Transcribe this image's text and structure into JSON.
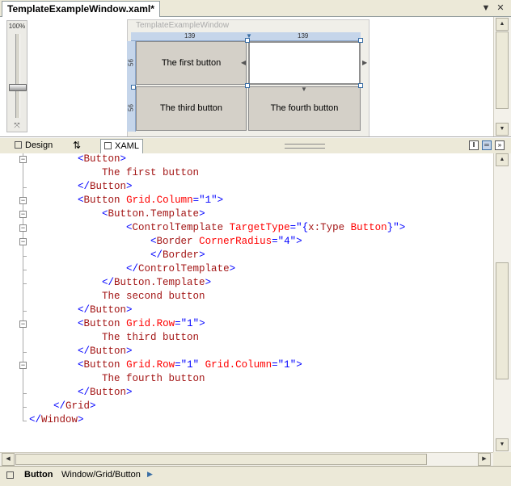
{
  "document_tab": {
    "title": "TemplateExampleWindow.xaml*"
  },
  "window_controls": {
    "dropdown": "▼",
    "close": "✕"
  },
  "designer": {
    "zoom": "100%",
    "window_title": "TemplateExampleWindow",
    "column_widths": [
      "139",
      "139"
    ],
    "row_heights": [
      "56",
      "56"
    ],
    "cells": [
      "The first button",
      "",
      "The third button",
      "The fourth button"
    ]
  },
  "view_tabs": {
    "design": "Design",
    "swap": "⇅",
    "xaml": "XAML"
  },
  "code": [
    [
      {
        "t": "        "
      },
      {
        "c": "b",
        "t": "<"
      },
      {
        "c": "m",
        "t": "Button"
      },
      {
        "c": "b",
        "t": ">"
      }
    ],
    [
      {
        "t": "            "
      },
      {
        "c": "m",
        "t": "The first button"
      }
    ],
    [
      {
        "t": "        "
      },
      {
        "c": "b",
        "t": "</"
      },
      {
        "c": "m",
        "t": "Button"
      },
      {
        "c": "b",
        "t": ">"
      }
    ],
    [
      {
        "t": "        "
      },
      {
        "c": "b",
        "t": "<"
      },
      {
        "c": "m",
        "t": "Button"
      },
      {
        "t": " "
      },
      {
        "c": "r",
        "t": "Grid.Column"
      },
      {
        "c": "b",
        "t": "=\""
      },
      {
        "c": "b",
        "t": "1"
      },
      {
        "c": "b",
        "t": "\">"
      }
    ],
    [
      {
        "t": "            "
      },
      {
        "c": "b",
        "t": "<"
      },
      {
        "c": "m",
        "t": "Button.Template"
      },
      {
        "c": "b",
        "t": ">"
      }
    ],
    [
      {
        "t": "                "
      },
      {
        "c": "b",
        "t": "<"
      },
      {
        "c": "m",
        "t": "ControlTemplate"
      },
      {
        "t": " "
      },
      {
        "c": "r",
        "t": "TargetType"
      },
      {
        "c": "b",
        "t": "=\""
      },
      {
        "c": "b",
        "t": "{"
      },
      {
        "c": "m",
        "t": "x:Type"
      },
      {
        "t": " "
      },
      {
        "c": "r",
        "t": "Button"
      },
      {
        "c": "b",
        "t": "}"
      },
      {
        "c": "b",
        "t": "\">"
      }
    ],
    [
      {
        "t": "                    "
      },
      {
        "c": "b",
        "t": "<"
      },
      {
        "c": "m",
        "t": "Border"
      },
      {
        "t": " "
      },
      {
        "c": "r",
        "t": "CornerRadius"
      },
      {
        "c": "b",
        "t": "=\""
      },
      {
        "c": "b",
        "t": "4"
      },
      {
        "c": "b",
        "t": "\">"
      }
    ],
    [
      {
        "t": "                    "
      },
      {
        "c": "b",
        "t": "</"
      },
      {
        "c": "m",
        "t": "Border"
      },
      {
        "c": "b",
        "t": ">"
      }
    ],
    [
      {
        "t": "                "
      },
      {
        "c": "b",
        "t": "</"
      },
      {
        "c": "m",
        "t": "ControlTemplate"
      },
      {
        "c": "b",
        "t": ">"
      }
    ],
    [
      {
        "t": "            "
      },
      {
        "c": "b",
        "t": "</"
      },
      {
        "c": "m",
        "t": "Button.Template"
      },
      {
        "c": "b",
        "t": ">"
      }
    ],
    [
      {
        "t": "            "
      },
      {
        "c": "m",
        "t": "The second button"
      }
    ],
    [
      {
        "t": "        "
      },
      {
        "c": "b",
        "t": "</"
      },
      {
        "c": "m",
        "t": "Button"
      },
      {
        "c": "b",
        "t": ">"
      }
    ],
    [
      {
        "t": "        "
      },
      {
        "c": "b",
        "t": "<"
      },
      {
        "c": "m",
        "t": "Button"
      },
      {
        "t": " "
      },
      {
        "c": "r",
        "t": "Grid.Row"
      },
      {
        "c": "b",
        "t": "=\""
      },
      {
        "c": "b",
        "t": "1"
      },
      {
        "c": "b",
        "t": "\">"
      }
    ],
    [
      {
        "t": "            "
      },
      {
        "c": "m",
        "t": "The third button"
      }
    ],
    [
      {
        "t": "        "
      },
      {
        "c": "b",
        "t": "</"
      },
      {
        "c": "m",
        "t": "Button"
      },
      {
        "c": "b",
        "t": ">"
      }
    ],
    [
      {
        "t": "        "
      },
      {
        "c": "b",
        "t": "<"
      },
      {
        "c": "m",
        "t": "Button"
      },
      {
        "t": " "
      },
      {
        "c": "r",
        "t": "Grid.Row"
      },
      {
        "c": "b",
        "t": "=\""
      },
      {
        "c": "b",
        "t": "1"
      },
      {
        "c": "b",
        "t": "\""
      },
      {
        "t": " "
      },
      {
        "c": "r",
        "t": "Grid.Column"
      },
      {
        "c": "b",
        "t": "=\""
      },
      {
        "c": "b",
        "t": "1"
      },
      {
        "c": "b",
        "t": "\">"
      }
    ],
    [
      {
        "t": "            "
      },
      {
        "c": "m",
        "t": "The fourth button"
      }
    ],
    [
      {
        "t": "        "
      },
      {
        "c": "b",
        "t": "</"
      },
      {
        "c": "m",
        "t": "Button"
      },
      {
        "c": "b",
        "t": ">"
      }
    ],
    [
      {
        "t": "    "
      },
      {
        "c": "b",
        "t": "</"
      },
      {
        "c": "m",
        "t": "Grid"
      },
      {
        "c": "b",
        "t": ">"
      }
    ],
    [
      {
        "c": "b",
        "t": "</"
      },
      {
        "c": "m",
        "t": "Window"
      },
      {
        "c": "b",
        "t": ">"
      }
    ]
  ],
  "status": {
    "selected": "Button",
    "path": "Window/Grid/Button"
  },
  "colors": {
    "tag": "#0000ff",
    "element": "#a31515",
    "attribute": "#ff0000",
    "chrome": "#ece9d8"
  }
}
